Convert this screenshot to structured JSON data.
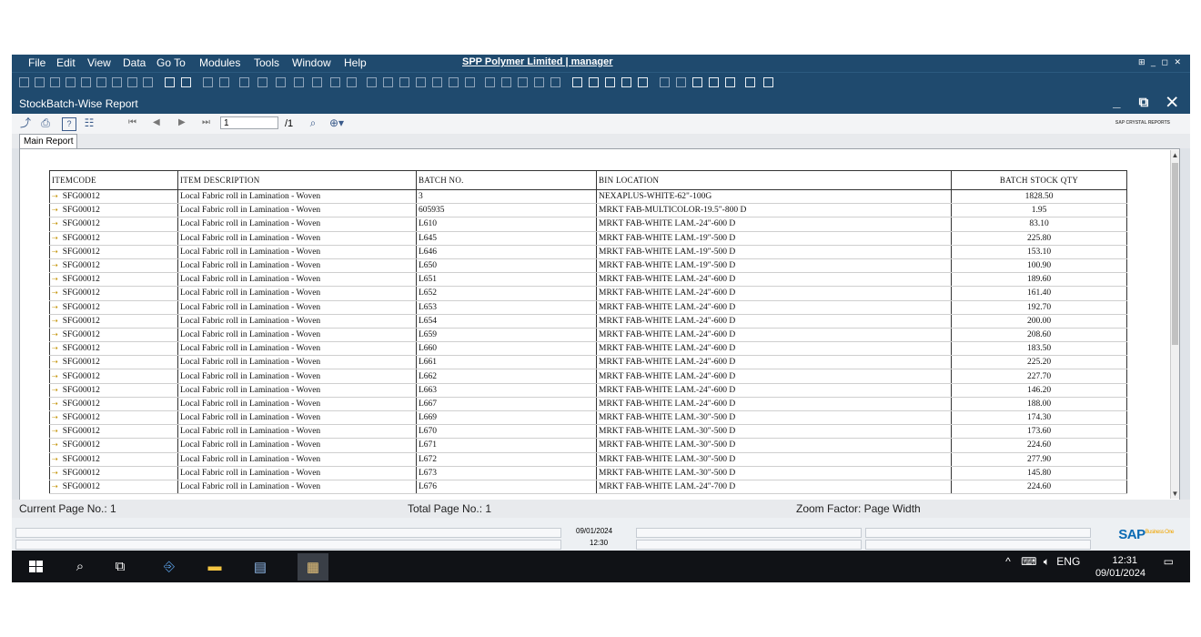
{
  "menu": [
    "File",
    "Edit",
    "View",
    "Data",
    "Go To",
    "Modules",
    "Tools",
    "Window",
    "Help"
  ],
  "app_title": "SPP Polymer Limited | manager",
  "report_window_title": "StockBatch-Wise Report",
  "crystal": {
    "page_input": "1",
    "page_total": "/1",
    "brand": "SAP CRYSTAL REPORTS"
  },
  "tab_label": "Main Report",
  "columns": [
    "ITEMCODE",
    "ITEM DESCRIPTION",
    "BATCH NO.",
    "BIN LOCATION",
    "BATCH STOCK QTY"
  ],
  "rows": [
    [
      "SFG00012",
      "Local Fabric roll in Lamination - Woven",
      "3",
      "NEXAPLUS-WHITE-62\"-100G",
      "1828.50"
    ],
    [
      "SFG00012",
      "Local Fabric roll in Lamination - Woven",
      "605935",
      "MRKT FAB-MULTICOLOR-19.5\"-800 D",
      "1.95"
    ],
    [
      "SFG00012",
      "Local Fabric roll in Lamination - Woven",
      "L610",
      "MRKT FAB-WHITE LAM.-24\"-600 D",
      "83.10"
    ],
    [
      "SFG00012",
      "Local Fabric roll in Lamination - Woven",
      "L645",
      "MRKT FAB-WHITE LAM.-19\"-500 D",
      "225.80"
    ],
    [
      "SFG00012",
      "Local Fabric roll in Lamination - Woven",
      "L646",
      "MRKT FAB-WHITE LAM.-19\"-500 D",
      "153.10"
    ],
    [
      "SFG00012",
      "Local Fabric roll in Lamination - Woven",
      "L650",
      "MRKT FAB-WHITE LAM.-19\"-500 D",
      "100.90"
    ],
    [
      "SFG00012",
      "Local Fabric roll in Lamination - Woven",
      "L651",
      "MRKT FAB-WHITE LAM.-24\"-600 D",
      "189.60"
    ],
    [
      "SFG00012",
      "Local Fabric roll in Lamination - Woven",
      "L652",
      "MRKT FAB-WHITE LAM.-24\"-600 D",
      "161.40"
    ],
    [
      "SFG00012",
      "Local Fabric roll in Lamination - Woven",
      "L653",
      "MRKT FAB-WHITE LAM.-24\"-600 D",
      "192.70"
    ],
    [
      "SFG00012",
      "Local Fabric roll in Lamination - Woven",
      "L654",
      "MRKT FAB-WHITE LAM.-24\"-600 D",
      "200.00"
    ],
    [
      "SFG00012",
      "Local Fabric roll in Lamination - Woven",
      "L659",
      "MRKT FAB-WHITE LAM.-24\"-600 D",
      "208.60"
    ],
    [
      "SFG00012",
      "Local Fabric roll in Lamination - Woven",
      "L660",
      "MRKT FAB-WHITE LAM.-24\"-600 D",
      "183.50"
    ],
    [
      "SFG00012",
      "Local Fabric roll in Lamination - Woven",
      "L661",
      "MRKT FAB-WHITE LAM.-24\"-600 D",
      "225.20"
    ],
    [
      "SFG00012",
      "Local Fabric roll in Lamination - Woven",
      "L662",
      "MRKT FAB-WHITE LAM.-24\"-600 D",
      "227.70"
    ],
    [
      "SFG00012",
      "Local Fabric roll in Lamination - Woven",
      "L663",
      "MRKT FAB-WHITE LAM.-24\"-600 D",
      "146.20"
    ],
    [
      "SFG00012",
      "Local Fabric roll in Lamination - Woven",
      "L667",
      "MRKT FAB-WHITE LAM.-24\"-600 D",
      "188.00"
    ],
    [
      "SFG00012",
      "Local Fabric roll in Lamination - Woven",
      "L669",
      "MRKT FAB-WHITE LAM.-30\"-500 D",
      "174.30"
    ],
    [
      "SFG00012",
      "Local Fabric roll in Lamination - Woven",
      "L670",
      "MRKT FAB-WHITE LAM.-30\"-500 D",
      "173.60"
    ],
    [
      "SFG00012",
      "Local Fabric roll in Lamination - Woven",
      "L671",
      "MRKT FAB-WHITE LAM.-30\"-500 D",
      "224.60"
    ],
    [
      "SFG00012",
      "Local Fabric roll in Lamination - Woven",
      "L672",
      "MRKT FAB-WHITE LAM.-30\"-500 D",
      "277.90"
    ],
    [
      "SFG00012",
      "Local Fabric roll in Lamination - Woven",
      "L673",
      "MRKT FAB-WHITE LAM.-30\"-500 D",
      "145.80"
    ],
    [
      "SFG00012",
      "Local Fabric roll in Lamination - Woven",
      "L676",
      "MRKT FAB-WHITE LAM.-24\"-700 D",
      "224.60"
    ]
  ],
  "status": {
    "current_page": "Current Page No.: 1",
    "total_page": "Total Page No.: 1",
    "zoom": "Zoom Factor: Page Width"
  },
  "sap_bar": {
    "date": "09/01/2024",
    "time": "12:30",
    "logo": "SAP",
    "logo_sub": "Business One"
  },
  "taskbar": {
    "lang": "ENG",
    "time": "12:31",
    "date": "09/01/2024"
  },
  "colors": {
    "title_bar": "#1f4a6e",
    "taskbar": "#101216",
    "drill_icon": "#c5960d"
  }
}
